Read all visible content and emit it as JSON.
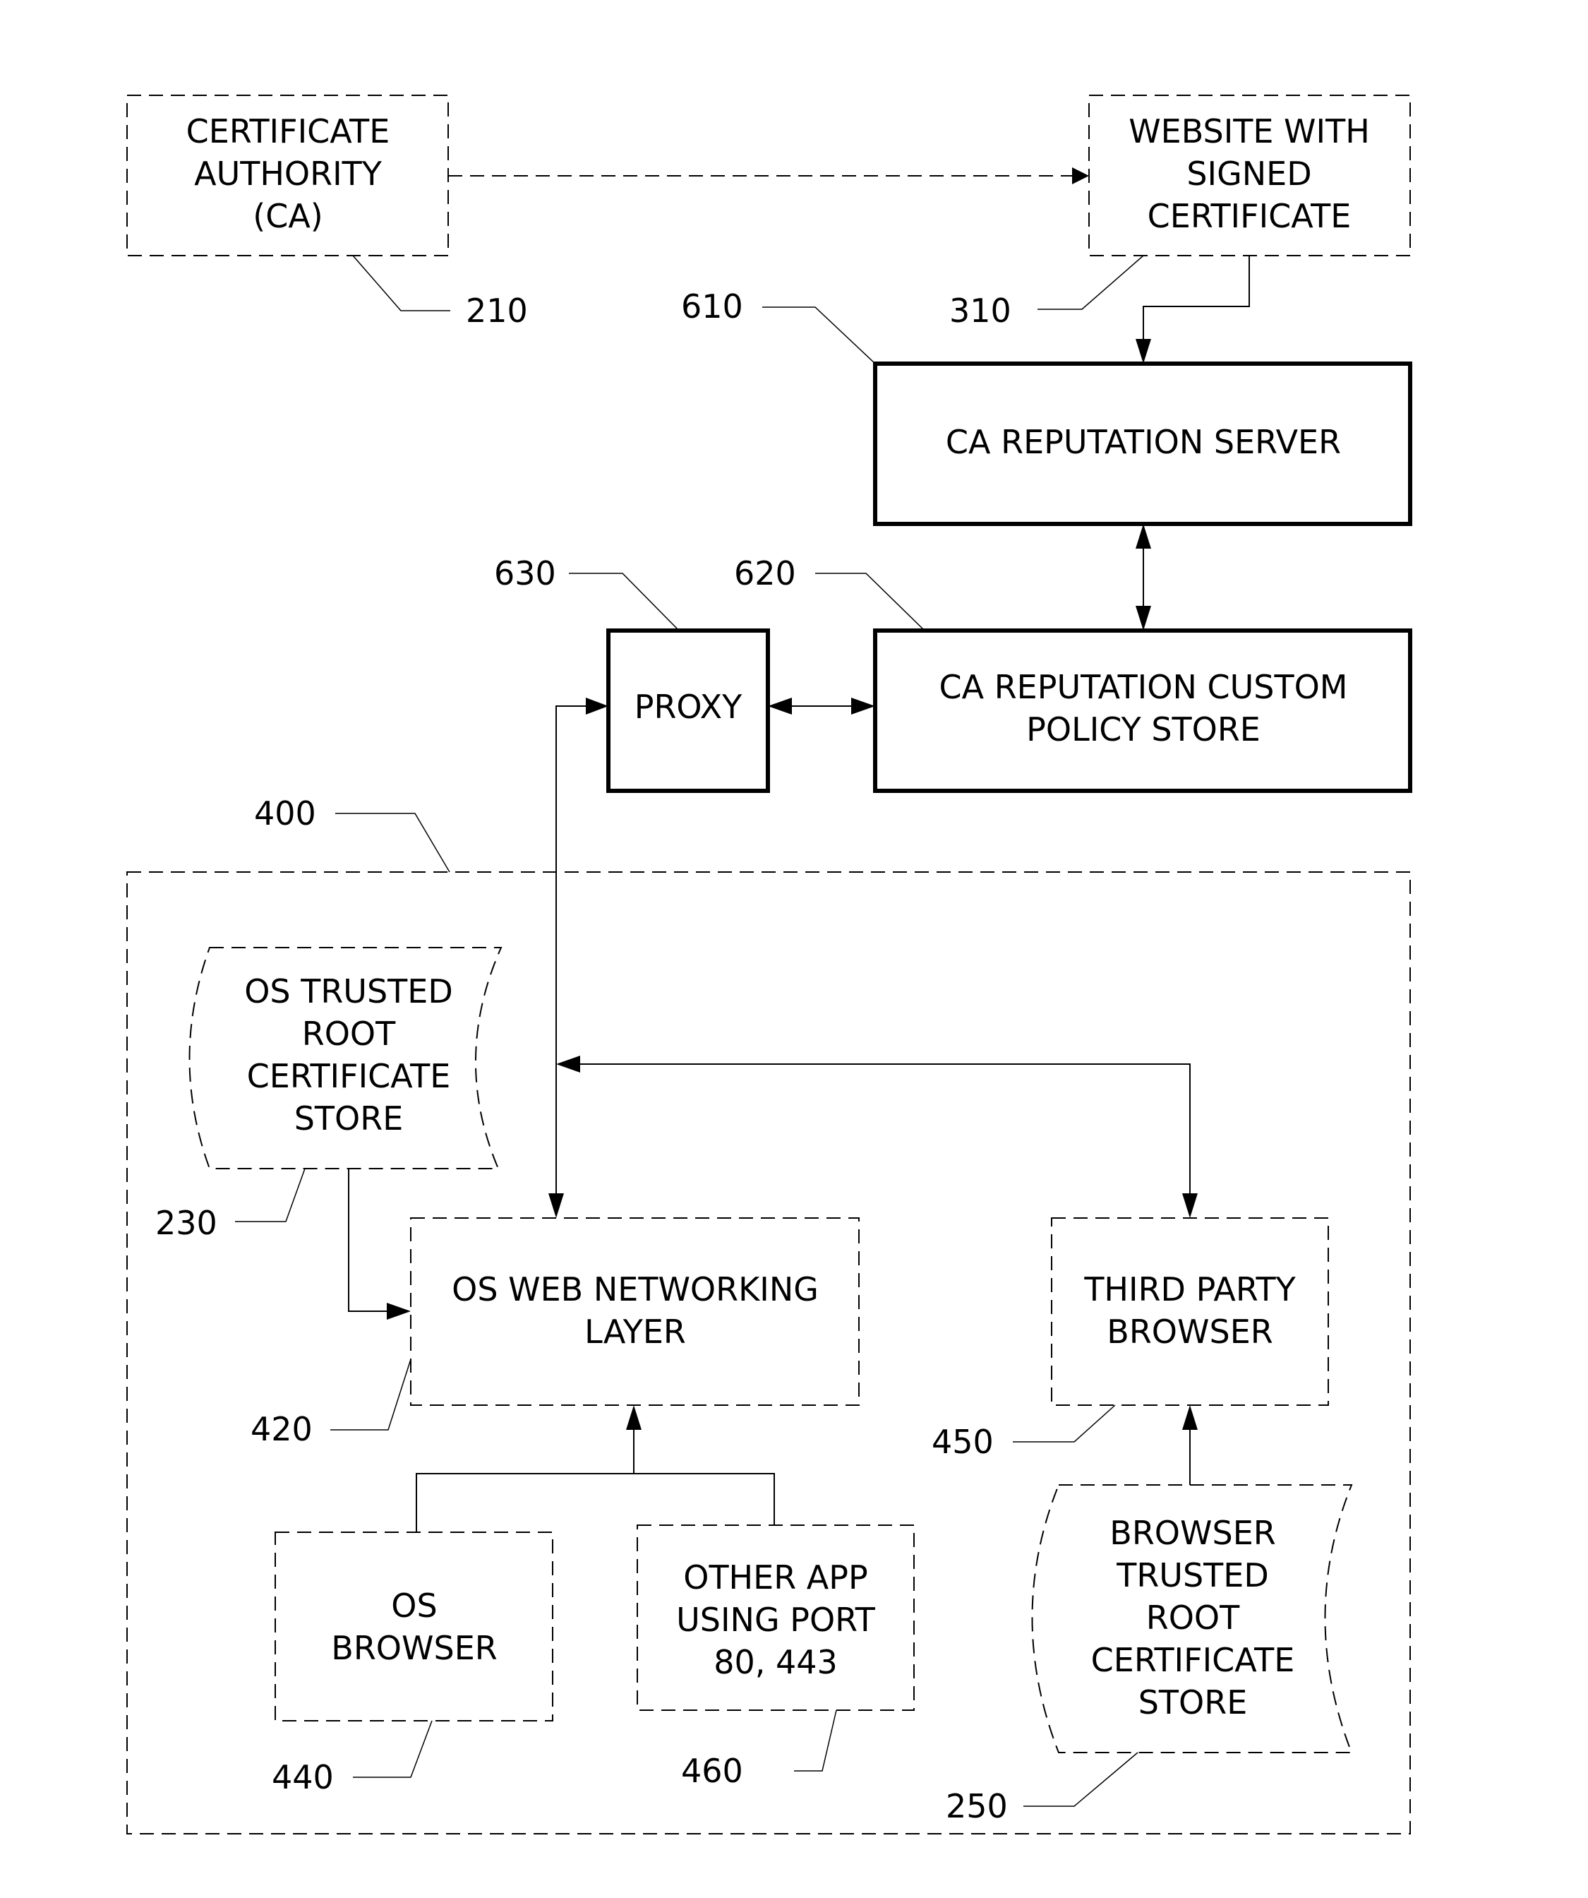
{
  "diagram": {
    "nodes": {
      "ca": {
        "ref": "210",
        "lines": [
          "CERTIFICATE",
          "AUTHORITY",
          "(CA)"
        ],
        "style": "dashed"
      },
      "website": {
        "ref": "310",
        "lines": [
          "WEBSITE WITH",
          "SIGNED",
          "CERTIFICATE"
        ],
        "style": "dashed"
      },
      "rep_server": {
        "ref": "610",
        "lines": [
          "CA REPUTATION SERVER"
        ],
        "style": "solid"
      },
      "policy_store": {
        "ref": "620",
        "lines": [
          "CA REPUTATION CUSTOM",
          "POLICY STORE"
        ],
        "style": "solid"
      },
      "proxy": {
        "ref": "630",
        "lines": [
          "PROXY"
        ],
        "style": "solid"
      },
      "client": {
        "ref": "400",
        "lines": [],
        "style": "dashed-container"
      },
      "os_store": {
        "ref": "230",
        "lines": [
          "OS TRUSTED",
          "ROOT",
          "CERTIFICATE",
          "STORE"
        ],
        "style": "dashed-storage"
      },
      "os_net": {
        "ref": "420",
        "lines": [
          "OS WEB NETWORKING",
          "LAYER"
        ],
        "style": "dashed"
      },
      "third_browser": {
        "ref": "450",
        "lines": [
          "THIRD PARTY",
          "BROWSER"
        ],
        "style": "dashed"
      },
      "os_browser": {
        "ref": "440",
        "lines": [
          "OS",
          "BROWSER"
        ],
        "style": "dashed"
      },
      "other_app": {
        "ref": "460",
        "lines": [
          "OTHER APP",
          "USING PORT",
          "80, 443"
        ],
        "style": "dashed"
      },
      "browser_store": {
        "ref": "250",
        "lines": [
          "BROWSER",
          "TRUSTED",
          "ROOT",
          "CERTIFICATE",
          "STORE"
        ],
        "style": "dashed-storage"
      }
    },
    "edges": [
      {
        "from": "ca",
        "to": "website",
        "style": "dashed",
        "arrow": "end"
      },
      {
        "from": "website",
        "to": "rep_server",
        "style": "solid",
        "arrow": "end"
      },
      {
        "from": "rep_server",
        "to": "policy_store",
        "style": "solid",
        "arrow": "both"
      },
      {
        "from": "proxy",
        "to": "policy_store",
        "style": "solid",
        "arrow": "both"
      },
      {
        "from": "os_net",
        "to": "proxy",
        "style": "solid",
        "arrow": "both"
      },
      {
        "from": "third_browser",
        "to": "proxy-line",
        "style": "solid",
        "arrow": "both"
      },
      {
        "from": "os_store",
        "to": "os_net",
        "style": "solid",
        "arrow": "end"
      },
      {
        "from": "os_browser",
        "to": "os_net",
        "style": "solid",
        "arrow": "end"
      },
      {
        "from": "other_app",
        "to": "os_net",
        "style": "solid",
        "arrow": "end"
      },
      {
        "from": "browser_store",
        "to": "third_browser",
        "style": "solid",
        "arrow": "end"
      }
    ]
  }
}
